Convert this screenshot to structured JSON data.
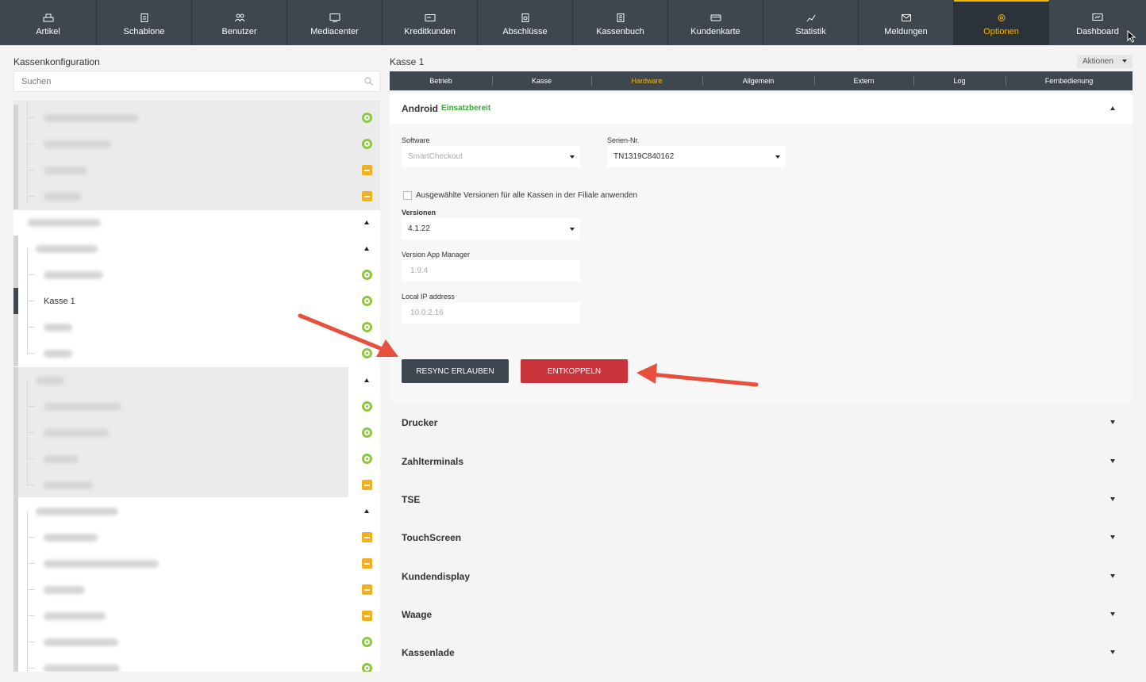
{
  "nav": {
    "items": [
      {
        "label": "Artikel",
        "icon": "register-icon"
      },
      {
        "label": "Schablone",
        "icon": "template-icon"
      },
      {
        "label": "Benutzer",
        "icon": "users-icon"
      },
      {
        "label": "Mediacenter",
        "icon": "monitor-icon"
      },
      {
        "label": "Kreditkunden",
        "icon": "card-icon"
      },
      {
        "label": "Abschlüsse",
        "icon": "document-icon"
      },
      {
        "label": "Kassenbuch",
        "icon": "book-icon"
      },
      {
        "label": "Kundenkarte",
        "icon": "customer-card-icon"
      },
      {
        "label": "Statistik",
        "icon": "chart-icon"
      },
      {
        "label": "Meldungen",
        "icon": "mail-icon"
      },
      {
        "label": "Optionen",
        "icon": "gear-icon",
        "active": true
      },
      {
        "label": "Dashboard",
        "icon": "dashboard-icon"
      }
    ]
  },
  "left": {
    "title": "Kassenkonfiguration",
    "search_placeholder": "Suchen",
    "selected_item": "Kasse 1"
  },
  "right": {
    "title": "Kasse 1",
    "actions_label": "Aktionen",
    "tabs": [
      {
        "label": "Betrieb"
      },
      {
        "label": "Kasse"
      },
      {
        "label": "Hardware",
        "active": true
      },
      {
        "label": "Allgemein"
      },
      {
        "label": "Extern"
      },
      {
        "label": "Log"
      },
      {
        "label": "Fernbedienung"
      }
    ],
    "android": {
      "title": "Android",
      "status": "Einsatzbereit",
      "software_label": "Software",
      "software_value": "SmartCheckout",
      "serial_label": "Serien-Nr.",
      "serial_value": "TN1319C840162",
      "apply_all_label": "Ausgewählte Versionen für alle Kassen in der Filiale anwenden",
      "versions_label": "Versionen",
      "versions_value": "4.1.22",
      "app_manager_label": "Version App Manager",
      "app_manager_value": "1.9.4",
      "ip_label": "Local IP address",
      "ip_value": "10.0.2.16",
      "resync_button": "RESYNC ERLAUBEN",
      "decouple_button": "ENTKOPPELN"
    },
    "sections": [
      "Drucker",
      "Zahlterminals",
      "TSE",
      "TouchScreen",
      "Kundendisplay",
      "Waage",
      "Kassenlade"
    ]
  },
  "colors": {
    "nav_bg": "#3e4650",
    "accent": "#f3b600",
    "danger": "#c9333c",
    "success": "#39a635",
    "arrow": "#e8503e"
  }
}
